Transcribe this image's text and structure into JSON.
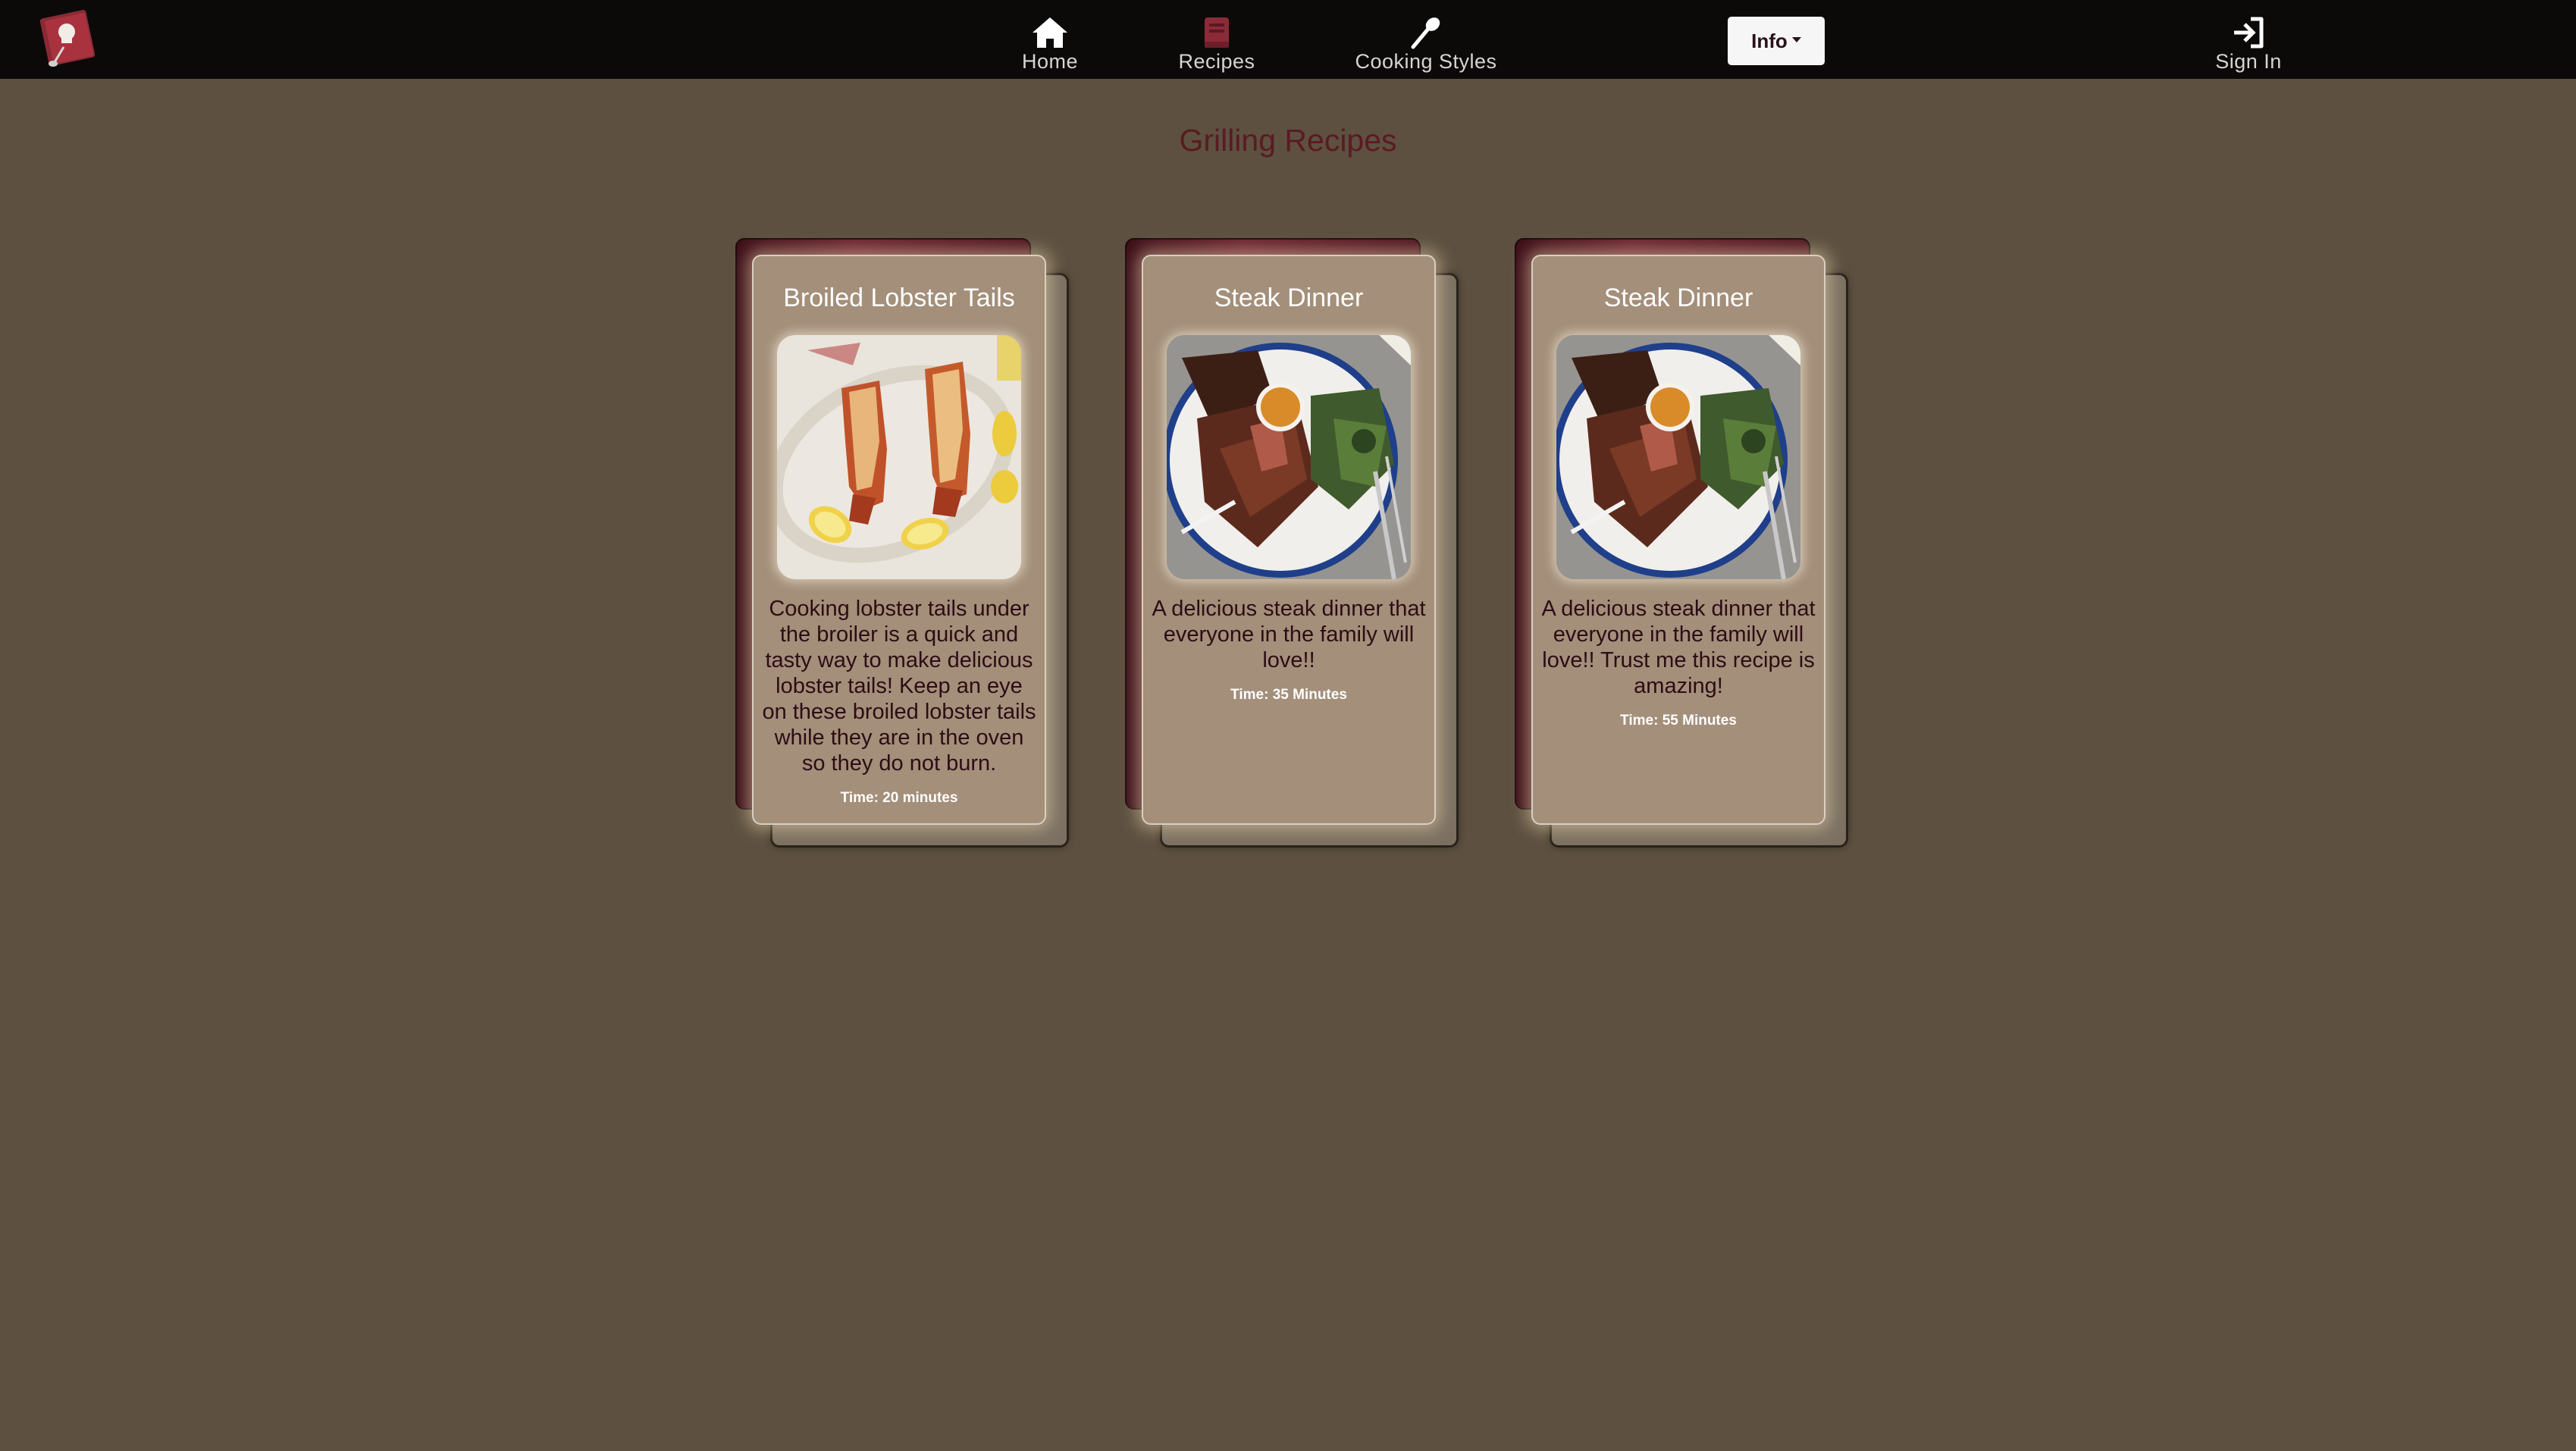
{
  "nav": {
    "home_label": "Home",
    "recipes_label": "Recipes",
    "styles_label": "Cooking Styles",
    "info_label": "Info",
    "signin_label": "Sign In",
    "icons": {
      "home": "home-icon",
      "recipes": "book-icon",
      "styles": "spoon-icon",
      "signin": "sign-in-icon",
      "logo": "chef-cookbook-logo"
    }
  },
  "page": {
    "title": "Grilling Recipes"
  },
  "recipes": [
    {
      "title": "Broiled Lobster Tails",
      "description": "Cooking lobster tails under the broiler is a quick and tasty way to make delicious lobster tails! Keep an eye on these broiled lobster tails while they are in the oven so they do not burn.",
      "time": "Time: 20 minutes",
      "image": "broiled-lobster-tails-photo"
    },
    {
      "title": "Steak Dinner",
      "description": "A delicious steak dinner that everyone in the family will love!!",
      "time": "Time: 35 Minutes",
      "image": "steak-dinner-photo"
    },
    {
      "title": "Steak Dinner",
      "description": "A delicious steak dinner that everyone in the family will love!! Trust me this recipe is amazing!",
      "time": "Time: 55 Minutes",
      "image": "steak-dinner-photo"
    }
  ],
  "colors": {
    "background": "#5d5040",
    "navbar": "#0b0a09",
    "accent_maroon": "#6b2430",
    "card_face": "#a38f7a",
    "title_color": "#5a1a24"
  }
}
